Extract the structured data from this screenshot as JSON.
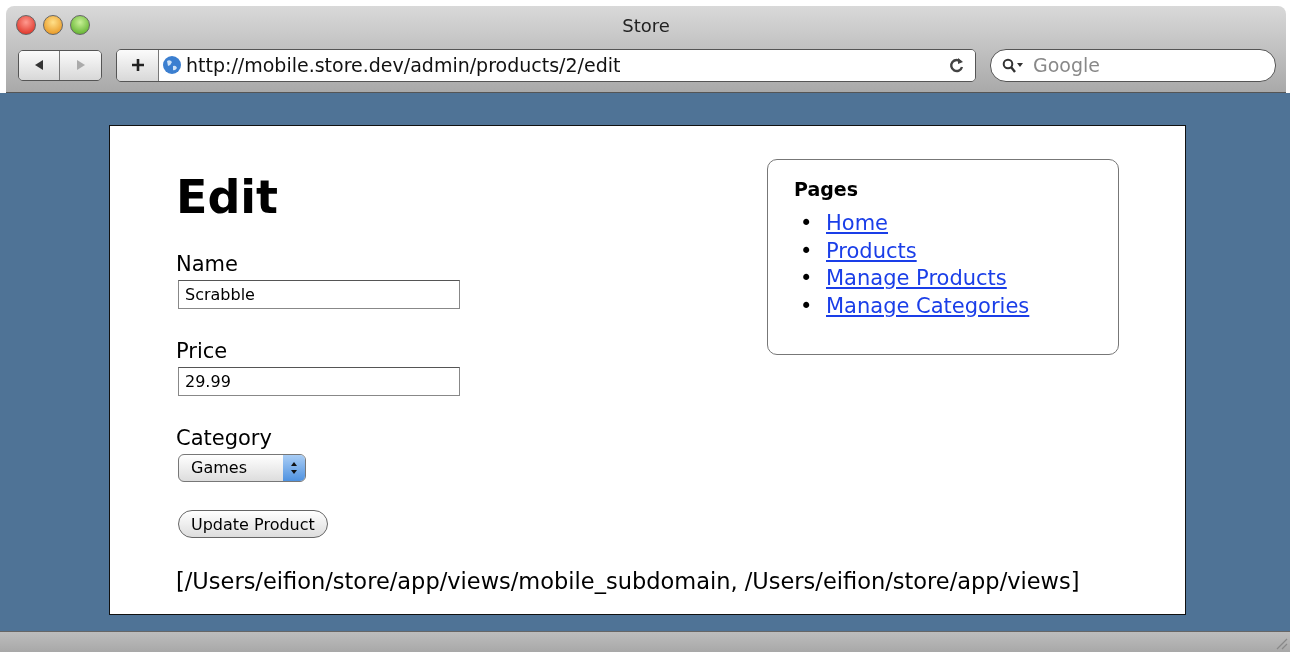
{
  "window": {
    "title": "Store"
  },
  "toolbar": {
    "url": "http://mobile.store.dev/admin/products/2/edit",
    "search": {
      "placeholder": "Google"
    }
  },
  "page": {
    "heading": "Edit",
    "fields": [
      {
        "kind": "text",
        "label": "Name",
        "value": "Scrabble"
      },
      {
        "kind": "text",
        "label": "Price",
        "value": "29.99"
      },
      {
        "kind": "select",
        "label": "Category",
        "value": "Games"
      }
    ],
    "submit": "Update Product",
    "paths": "[/Users/eifion/store/app/views/mobile_subdomain, /Users/eifion/store/app/views]"
  },
  "sidebar": {
    "title": "Pages",
    "links": [
      {
        "marker": "•",
        "label": "Home"
      },
      {
        "marker": "•",
        "label": "Products"
      },
      {
        "marker": "•",
        "label": "Manage Products"
      },
      {
        "marker": "•",
        "label": "Manage Categories"
      }
    ]
  }
}
